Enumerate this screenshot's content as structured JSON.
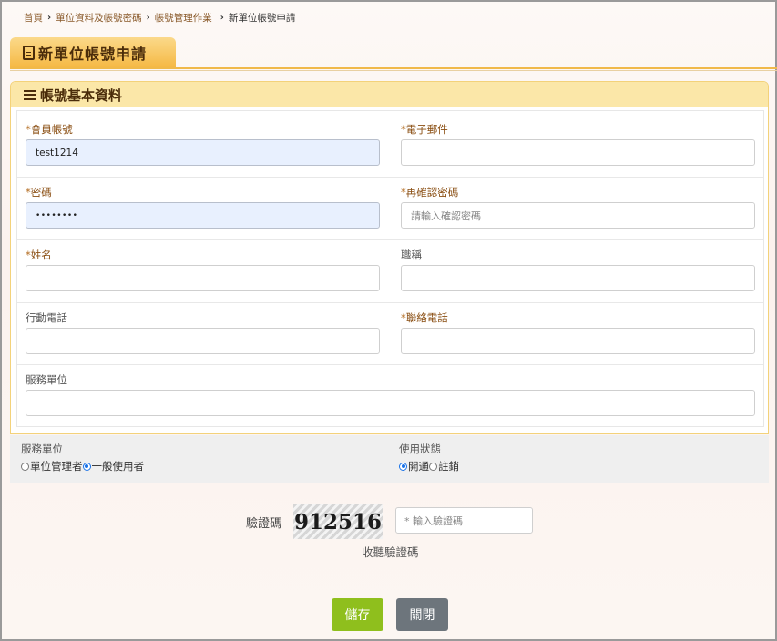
{
  "breadcrumb": [
    "首頁",
    "單位資料及帳號密碼",
    "帳號管理作業",
    "新單位帳號申請"
  ],
  "page_title": "新單位帳號申請",
  "panel_title": "帳號基本資料",
  "fields": {
    "account": {
      "label": "會員帳號",
      "required": "*",
      "value": "test1214"
    },
    "email": {
      "label": "電子郵件",
      "required": "*",
      "value": ""
    },
    "password": {
      "label": "密碼",
      "required": "*",
      "value": "••••••••"
    },
    "confirm_password": {
      "label": "再確認密碼",
      "required": "*",
      "placeholder": "請輸入確認密碼"
    },
    "name": {
      "label": "姓名",
      "required": "*",
      "value": ""
    },
    "job_title": {
      "label": "職稱",
      "value": ""
    },
    "mobile": {
      "label": "行動電話",
      "value": ""
    },
    "contact_phone": {
      "label": "聯絡電話",
      "required": "*",
      "value": ""
    },
    "service_unit": {
      "label": "服務單位",
      "value": ""
    }
  },
  "options": {
    "service_unit": {
      "title": "服務單位",
      "choices": [
        "單位管理者",
        "一般使用者"
      ],
      "selected": "一般使用者"
    },
    "status": {
      "title": "使用狀態",
      "choices": [
        "開通",
        "註銷"
      ],
      "selected": "開通"
    }
  },
  "captcha": {
    "label": "驗證碼",
    "code": "912516",
    "placeholder": "* 輸入驗證碼",
    "audio_label": "收聽驗證碼"
  },
  "buttons": {
    "save": "儲存",
    "close": "關閉"
  },
  "colors": {
    "accent": "#f5b945",
    "save": "#8fbf1d",
    "close": "#6d757c",
    "radio": "#1a73e8"
  }
}
